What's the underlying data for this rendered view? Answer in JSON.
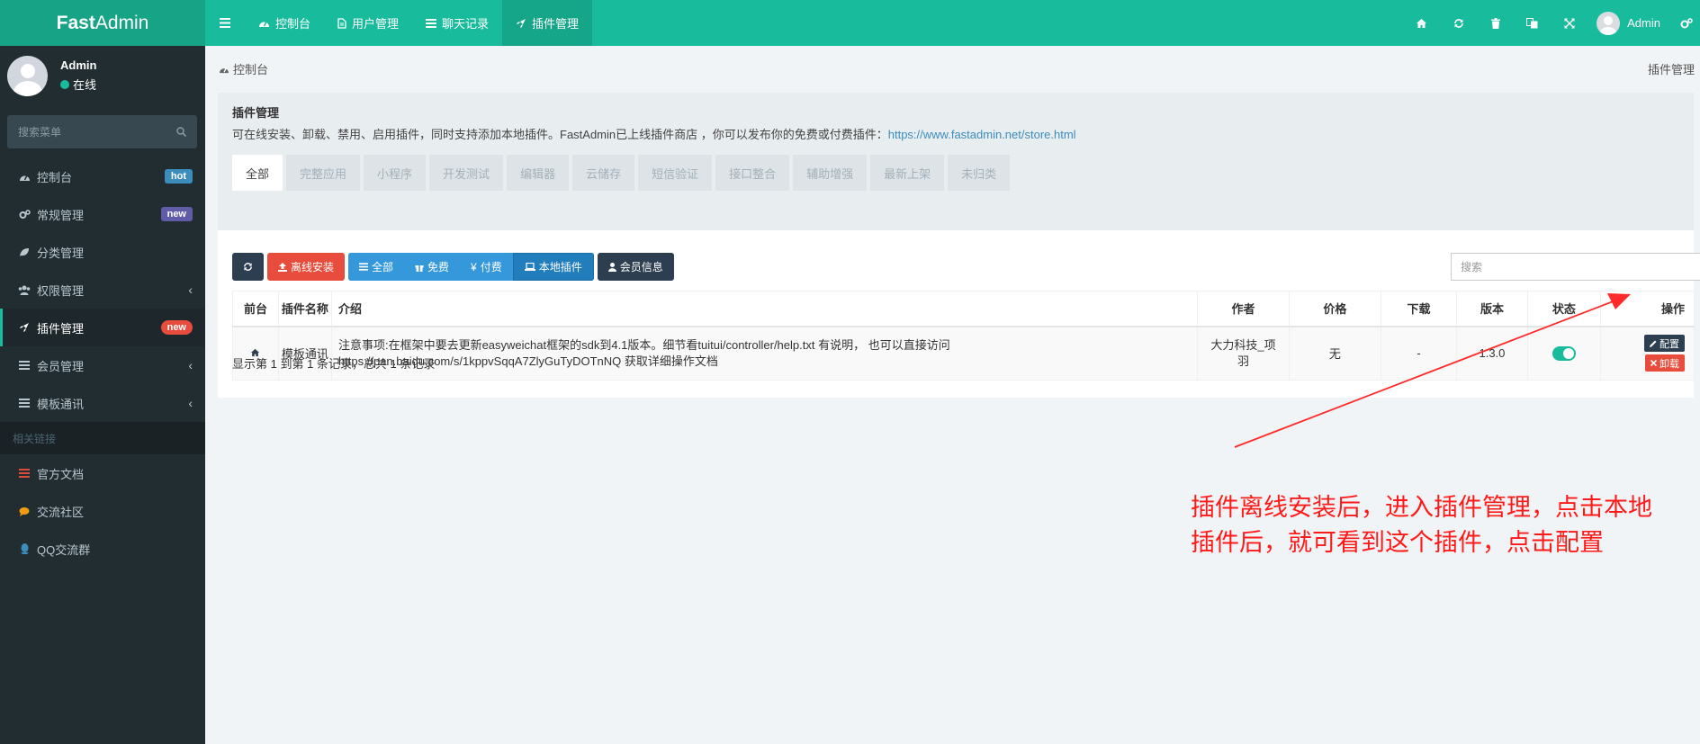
{
  "app": {
    "logo_bold": "Fast",
    "logo_rest": "Admin"
  },
  "topnav": {
    "items": [
      {
        "label": "控制台",
        "icon": "dashboard-icon"
      },
      {
        "label": "用户管理",
        "icon": "file-icon"
      },
      {
        "label": "聊天记录",
        "icon": "list-icon"
      },
      {
        "label": "插件管理",
        "icon": "rocket-icon",
        "active": true
      }
    ],
    "user_name": "Admin"
  },
  "sidebar": {
    "user_name": "Admin",
    "status": "在线",
    "search_placeholder": "搜索菜单",
    "items": [
      {
        "label": "控制台",
        "badge": "hot"
      },
      {
        "label": "常规管理",
        "badge": "new"
      },
      {
        "label": "分类管理"
      },
      {
        "label": "权限管理"
      },
      {
        "label": "插件管理",
        "badge": "new"
      },
      {
        "label": "会员管理"
      },
      {
        "label": "模板通讯"
      }
    ],
    "links_header": "相关链接",
    "links": [
      {
        "label": "官方文档",
        "color": "#dd4b39"
      },
      {
        "label": "交流社区",
        "color": "#f39c12"
      },
      {
        "label": "QQ交流群",
        "color": "#3c8dbc"
      }
    ]
  },
  "breadcrumb": {
    "home": "控制台",
    "current": "插件管理"
  },
  "panel": {
    "title": "插件管理",
    "desc": "可在线安装、卸载、禁用、启用插件，同时支持添加本地插件。FastAdmin已上线插件商店 ，你可以发布你的免费或付费插件：",
    "link": "https://www.fastadmin.net/store.html",
    "tabs": [
      "全部",
      "完整应用",
      "小程序",
      "开发测试",
      "编辑器",
      "云储存",
      "短信验证",
      "接口整合",
      "辅助增强",
      "最新上架",
      "未归类"
    ]
  },
  "toolbar": {
    "offline_install": "离线安装",
    "filters": [
      "全部",
      "免费",
      "付费",
      "本地插件"
    ],
    "member_info": "会员信息",
    "search_placeholder": "搜索"
  },
  "table": {
    "headers": [
      "前台",
      "插件名称",
      "介绍",
      "作者",
      "价格",
      "下载",
      "版本",
      "状态",
      "操作"
    ],
    "rows": [
      {
        "name": "模板通讯",
        "intro_line1": "注意事项:在框架中要去更新easyweichat框架的sdk到4.1版本。细节看tuitui/controller/help.txt 有说明， 也可以直接访问",
        "intro_line2": "https://pan.baidu.com/s/1kppvSqqA7ZlyGuTyDOTnNQ 获取详细操作文档",
        "author_line1": "大力科技_项",
        "author_line2": "羽",
        "price": "无",
        "downloads": "-",
        "version": "1.3.0",
        "enabled": true,
        "config_label": "配置",
        "uninstall_label": "卸载"
      }
    ]
  },
  "pager": {
    "info": "显示第 1 到第 1 条记录，总共 1 条记录"
  },
  "annotation": {
    "line1": "插件离线安装后，进入插件管理，点击本地",
    "line2": "插件后，就可看到这个插件，点击配置",
    "color": "#ff1a1a"
  },
  "colors": {
    "brand": "#18bc9c",
    "sidebar": "#222d32",
    "danger": "#e74c3c",
    "primary": "#3498db"
  }
}
